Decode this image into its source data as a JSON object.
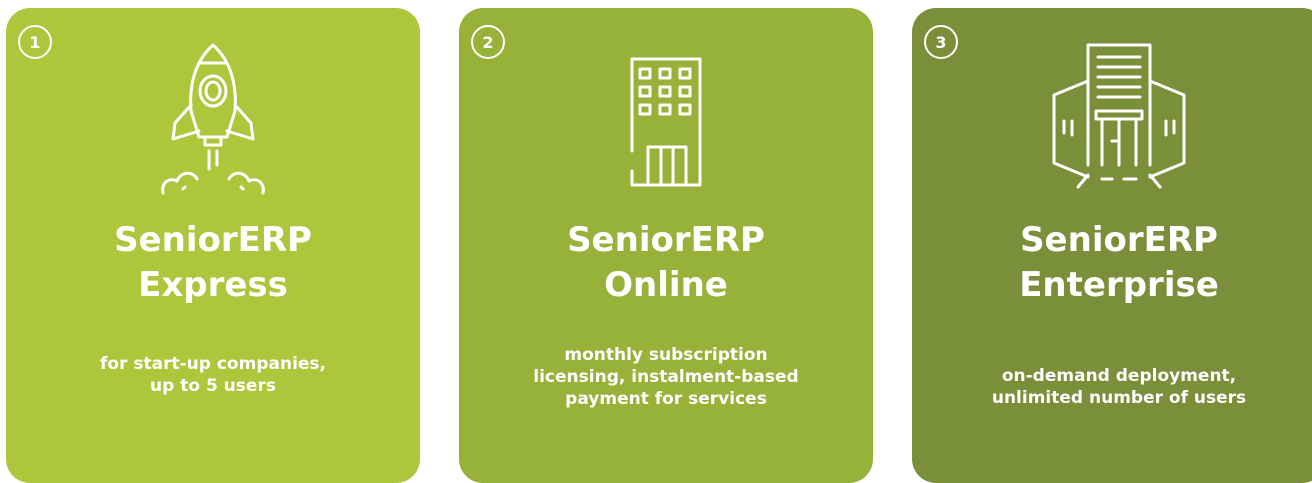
{
  "cards": [
    {
      "number": "1",
      "icon": "rocket-icon",
      "title_line1": "SeniorERP",
      "title_line2": "Express",
      "desc_line1": "for start-up companies,",
      "desc_line2": "up to 5 users",
      "color": "#adc73c"
    },
    {
      "number": "2",
      "icon": "office-building-icon",
      "title_line1": "SeniorERP",
      "title_line2": "Online",
      "desc_line1": "monthly subscription",
      "desc_line2": "licensing, instalment-based",
      "desc_line3": "payment for services",
      "color": "#96b238"
    },
    {
      "number": "3",
      "icon": "corporate-building-icon",
      "title_line1": "SeniorERP",
      "title_line2": "Enterprise",
      "desc_line1": "on-demand deployment,",
      "desc_line2": "unlimited number of users",
      "color": "#7a8f39"
    }
  ]
}
